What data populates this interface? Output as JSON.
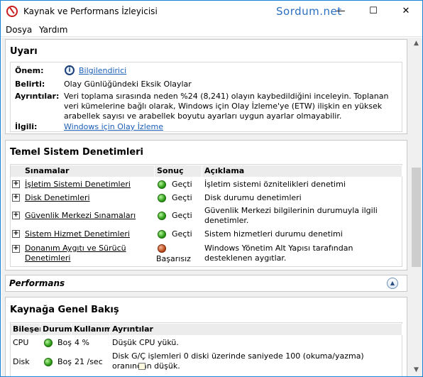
{
  "window": {
    "title": "Kaynak ve Performans İzleyicisi",
    "watermark": "Sordum.net",
    "controls": {
      "minimize": "—",
      "maximize": "☐",
      "close": "✕"
    }
  },
  "menu": {
    "file": "Dosya",
    "help": "Yardım"
  },
  "warning": {
    "title": "Uyarı",
    "rows": [
      {
        "label": "Önem:",
        "value": "Bilgilendirici"
      },
      {
        "label": "Belirti:",
        "value": "Olay Günlüğündeki Eksik Olaylar"
      },
      {
        "label": "Ayrıntılar:",
        "value": "Veri toplama sırasında neden %24 (8,241) olayın kaybedildiğini inceleyin. Toplanan veri kümelerine bağlı olarak, Windows için Olay İzleme'ye (ETW) ilişkin en yüksek arabellek sayısı ve arabellek boyutu ayarları uygun ayarlar olmayabilir."
      },
      {
        "label": "İlgili:",
        "value": "Windows için Olay İzleme"
      }
    ]
  },
  "basic_checks": {
    "title": "Temel Sistem Denetimleri",
    "headers": [
      "Sınamalar",
      "Sonuç",
      "Açıklama"
    ],
    "rows": [
      {
        "test": "İşletim Sistemi Denetimleri",
        "result": "Geçti",
        "status": "pass",
        "description": "İşletim sistemi öznitelikleri denetimi"
      },
      {
        "test": "Disk Denetimleri",
        "result": "Geçti",
        "status": "pass",
        "description": "Disk durumu denetimleri"
      },
      {
        "test": "Güvenlik Merkezi Sınamaları",
        "result": "Geçti",
        "status": "pass",
        "description": "Güvenlik Merkezi bilgilerinin durumuyla ilgili denetimler."
      },
      {
        "test": "Sistem Hizmet Denetimleri",
        "result": "Geçti",
        "status": "pass",
        "description": "Sistem hizmetleri durumu denetimi"
      },
      {
        "test": "Donanım Aygıtı ve Sürücü Denetimleri",
        "result": "Başarısız",
        "status": "fail",
        "description": "Windows Yönetim Alt Yapısı tarafından desteklenen aygıtlar."
      }
    ]
  },
  "performance": {
    "title": "Performans",
    "collapse_icon": "▲"
  },
  "resource_overview": {
    "title": "Kaynağa Genel Bakış",
    "headers": [
      "Bileşen",
      "Durum",
      "Kullanım",
      "Ayrıntılar"
    ],
    "rows": [
      {
        "component": "CPU",
        "status": "Boş",
        "usage": "4 %",
        "details": "Düşük CPU yükü."
      },
      {
        "component": "Disk",
        "status": "Boş",
        "usage": "21 /sec",
        "details": "Disk G/Ç işlemleri 0 diski üzerinde saniyede 100 (okuma/yazma) oranından düşük."
      }
    ]
  },
  "colors": {
    "accent": "#1883d7",
    "link": "#1a5eb8",
    "pass": "#2e9e18",
    "fail": "#c0501e"
  }
}
